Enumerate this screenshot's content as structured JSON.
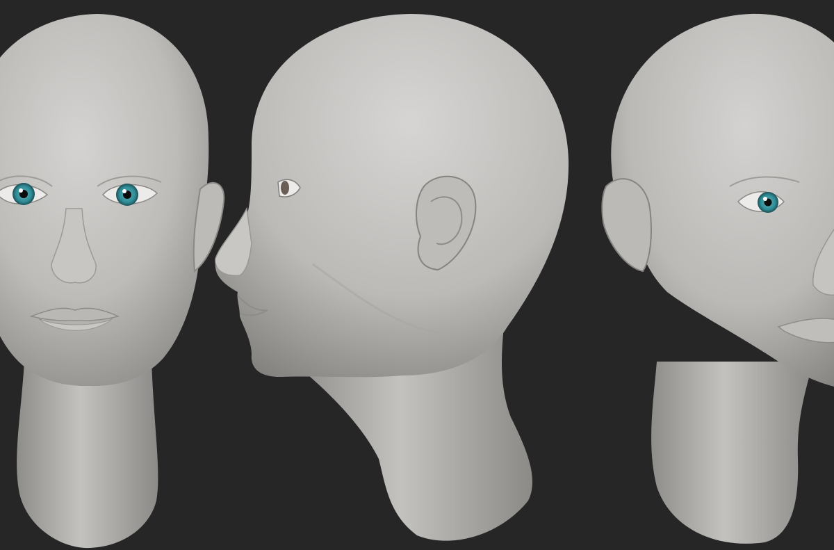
{
  "scene": {
    "background_color": "#262626",
    "clay_color": "#c2c0bd",
    "clay_shadow_color": "#6e6c69",
    "iris_color": "#2f8c96",
    "pupil_color": "#0c0c0c",
    "sclera_color": "#ecebea",
    "views": [
      {
        "name": "front-view",
        "icon": "sculpted-head-front"
      },
      {
        "name": "side-view",
        "icon": "sculpted-head-profile"
      },
      {
        "name": "three-quarter-view",
        "icon": "sculpted-head-three-quarter"
      }
    ]
  }
}
